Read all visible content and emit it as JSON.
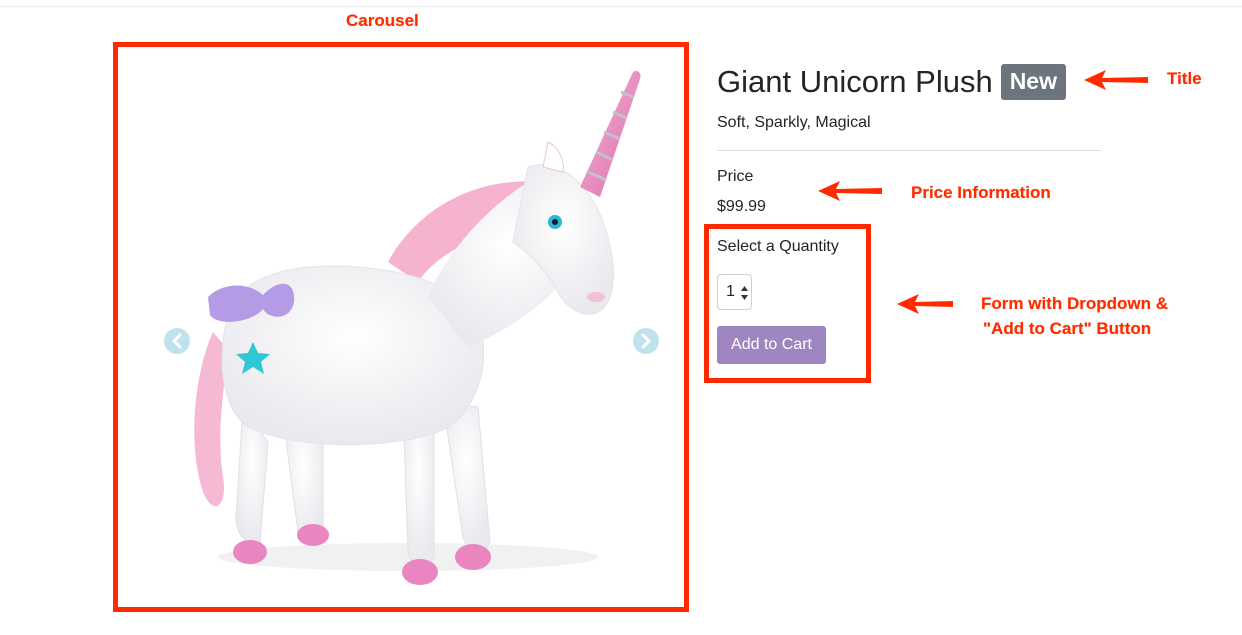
{
  "annotations": {
    "carousel": "Carousel",
    "title": "Title",
    "price": "Price Information",
    "form_line1": "Form with Dropdown &",
    "form_line2": "\"Add to Cart\" Button"
  },
  "product": {
    "title": "Giant Unicorn Plush",
    "badge": "New",
    "subtitle": "Soft, Sparkly, Magical",
    "price_label": "Price",
    "price": "$99.99",
    "quantity_label": "Select a Quantity",
    "quantity_value": "1",
    "add_to_cart": "Add to Cart"
  },
  "colors": {
    "annotation": "#ff2a00",
    "badge": "#6c757d",
    "button": "#9f86c0",
    "carousel_control": "#bfe3ec"
  },
  "icons": {
    "carousel_prev": "chevron-left-icon",
    "carousel_next": "chevron-right-icon",
    "select_arrows": "up-down-arrows-icon"
  }
}
